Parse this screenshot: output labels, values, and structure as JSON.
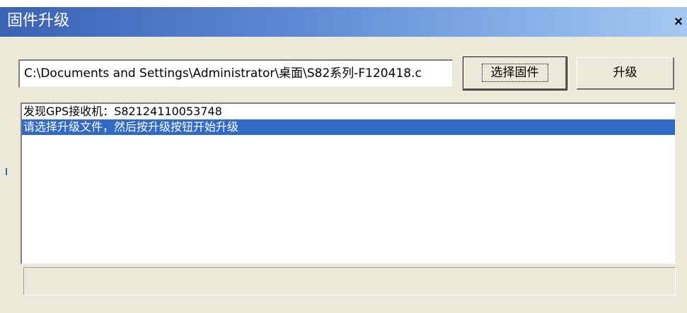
{
  "window": {
    "title": "固件升级",
    "close_label": "×"
  },
  "file": {
    "path_value": "C:\\Documents and Settings\\Administrator\\桌面\\S82系列-F120418.c"
  },
  "buttons": {
    "select_firmware": "选择固件",
    "upgrade": "升级"
  },
  "log": {
    "items": [
      {
        "text": "发现GPS接收机：S82124110053748",
        "selected": false
      },
      {
        "text": "请选择升级文件，然后按升级按钮开始升级",
        "selected": true
      }
    ]
  },
  "status": {
    "text": ""
  },
  "colors": {
    "titlebar_start": "#3a63b3",
    "titlebar_end": "#a6c8f2",
    "selection": "#316ac5",
    "dialog_bg": "#ece9d8"
  }
}
